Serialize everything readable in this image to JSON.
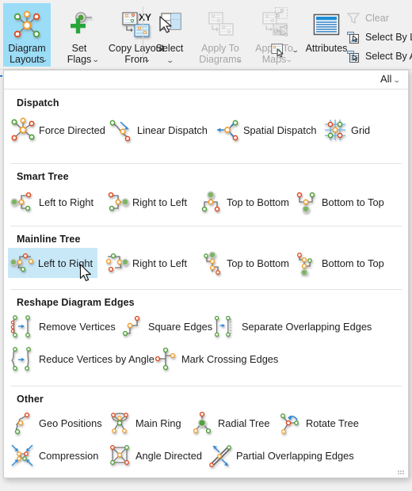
{
  "ribbon": {
    "groups": [
      {
        "buttons": [
          {
            "label": "Diagram\nLayouts",
            "icon": "diagram-layouts-icon",
            "selected": true,
            "disabled": false,
            "caret": true
          },
          {
            "label": "Set\nFlags",
            "icon": "set-flags-icon",
            "selected": false,
            "disabled": false,
            "caret": true
          },
          {
            "label": "Copy Layout\nFrom",
            "icon": "copy-layout-from-icon",
            "selected": false,
            "disabled": false,
            "caret": true
          }
        ]
      },
      {
        "buttons": [
          {
            "label": "Select",
            "icon": "select-icon",
            "selected": false,
            "disabled": false,
            "caret": true
          },
          {
            "label": "Apply To\nDiagrams",
            "icon": "apply-to-diagrams-icon",
            "selected": false,
            "disabled": true,
            "caret": true
          },
          {
            "label": "Apply To\nMaps",
            "icon": "apply-to-maps-icon",
            "selected": false,
            "disabled": true,
            "caret": true
          }
        ]
      },
      {
        "buttons": [
          {
            "label": "Attributes",
            "icon": "attributes-icon",
            "selected": false,
            "disabled": false,
            "caret": false
          }
        ]
      }
    ],
    "mini_buttons": [
      {
        "icon": "extend-selection-icon",
        "disabled": true
      },
      {
        "icon": "trace-selection-icon",
        "disabled": true
      },
      {
        "icon": "selection-tools-icon",
        "disabled": false,
        "caret": true
      }
    ],
    "select_commands": [
      {
        "label": "Clear",
        "icon": "clear-selection-icon",
        "disabled": true
      },
      {
        "label": "Select By Lo",
        "icon": "select-by-location-icon",
        "disabled": false
      },
      {
        "label": "Select By At",
        "icon": "select-by-attributes-icon",
        "disabled": false
      }
    ]
  },
  "gallery": {
    "filter_label": "All",
    "sections": [
      {
        "title": "Dispatch",
        "rows": [
          [
            {
              "label": "Force Directed",
              "icon": "force-directed-icon",
              "selected": false
            },
            {
              "label": "Linear Dispatch",
              "icon": "linear-dispatch-icon",
              "selected": false
            },
            {
              "label": "Spatial Dispatch",
              "icon": "spatial-dispatch-icon",
              "selected": false
            },
            {
              "label": "Grid",
              "icon": "grid-icon",
              "selected": false
            }
          ]
        ]
      },
      {
        "title": "Smart Tree",
        "rows": [
          [
            {
              "label": "Left to Right",
              "icon": "smart-tree-left-to-right-icon",
              "selected": false
            },
            {
              "label": "Right to Left",
              "icon": "smart-tree-right-to-left-icon",
              "selected": false
            },
            {
              "label": "Top to Bottom",
              "icon": "smart-tree-top-to-bottom-icon",
              "selected": false
            },
            {
              "label": "Bottom to Top",
              "icon": "smart-tree-bottom-to-top-icon",
              "selected": false
            }
          ]
        ]
      },
      {
        "title": "Mainline Tree",
        "rows": [
          [
            {
              "label": "Left to Right",
              "icon": "mainline-tree-left-to-right-icon",
              "selected": true
            },
            {
              "label": "Right to Left",
              "icon": "mainline-tree-right-to-left-icon",
              "selected": false
            },
            {
              "label": "Top to Bottom",
              "icon": "mainline-tree-top-to-bottom-icon",
              "selected": false
            },
            {
              "label": "Bottom to Top",
              "icon": "mainline-tree-bottom-to-top-icon",
              "selected": false
            }
          ]
        ]
      },
      {
        "title": "Reshape Diagram Edges",
        "rows": [
          [
            {
              "label": "Remove Vertices",
              "icon": "remove-vertices-icon",
              "selected": false
            },
            {
              "label": "Square Edges",
              "icon": "square-edges-icon",
              "selected": false
            },
            {
              "label": "Separate Overlapping Edges",
              "icon": "separate-overlapping-edges-icon",
              "selected": false
            }
          ],
          [
            {
              "label": "Reduce Vertices by Angle",
              "icon": "reduce-vertices-by-angle-icon",
              "selected": false
            },
            {
              "label": "Mark Crossing Edges",
              "icon": "mark-crossing-edges-icon",
              "selected": false
            }
          ]
        ]
      },
      {
        "title": "Other",
        "rows": [
          [
            {
              "label": "Geo Positions",
              "icon": "geo-positions-icon",
              "selected": false
            },
            {
              "label": "Main Ring",
              "icon": "main-ring-icon",
              "selected": false
            },
            {
              "label": "Radial Tree",
              "icon": "radial-tree-icon",
              "selected": false
            },
            {
              "label": "Rotate Tree",
              "icon": "rotate-tree-icon",
              "selected": false
            }
          ],
          [
            {
              "label": "Compression",
              "icon": "compression-icon",
              "selected": false
            },
            {
              "label": "Angle Directed",
              "icon": "angle-directed-icon",
              "selected": false
            },
            {
              "label": "Partial Overlapping Edges",
              "icon": "partial-overlapping-edges-icon",
              "selected": false
            }
          ]
        ]
      }
    ]
  },
  "colors": {
    "accent_selected": "#9bdcf7",
    "item_selected": "#c8e8f8",
    "node_green": "#4f9e39",
    "node_orange": "#f0a030",
    "node_red": "#e04a1f",
    "arrow_blue": "#2e8ad6",
    "edge_gray": "#6e6e6e",
    "ribbon_bg": "#f0f0f0",
    "panel_bg": "#ffffff"
  }
}
